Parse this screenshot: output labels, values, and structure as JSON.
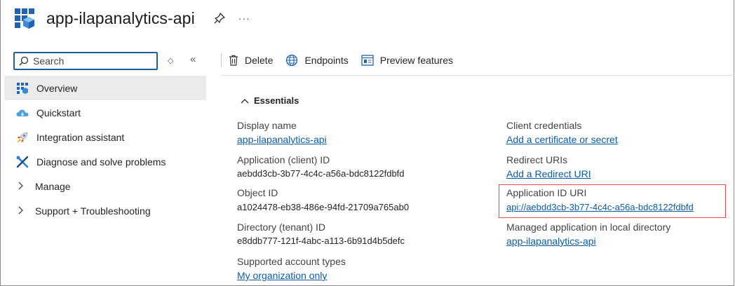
{
  "header": {
    "title": "app-ilapanalytics-api",
    "more_label": "···"
  },
  "sidebar": {
    "search_placeholder": "Search",
    "collapse_label": "«",
    "sort_label": "◇",
    "items": [
      {
        "label": "Overview"
      },
      {
        "label": "Quickstart"
      },
      {
        "label": "Integration assistant"
      },
      {
        "label": "Diagnose and solve problems"
      },
      {
        "label": "Manage"
      },
      {
        "label": "Support + Troubleshooting"
      }
    ]
  },
  "toolbar": {
    "delete_label": "Delete",
    "endpoints_label": "Endpoints",
    "preview_label": "Preview features"
  },
  "essentials": {
    "heading": "Essentials",
    "left": [
      {
        "label": "Display name",
        "value": "app-ilapanalytics-api",
        "link": true
      },
      {
        "label": "Application (client) ID",
        "value": "aebdd3cb-3b77-4c4c-a56a-bdc8122fdbfd",
        "link": false
      },
      {
        "label": "Object ID",
        "value": "a1024478-eb38-486e-94fd-21709a765ab0",
        "link": false
      },
      {
        "label": "Directory (tenant) ID",
        "value": "e8ddb777-121f-4abc-a113-6b91d4b5defc",
        "link": false
      },
      {
        "label": "Supported account types",
        "value": "My organization only",
        "link": true
      }
    ],
    "right": [
      {
        "label": "Client credentials",
        "value": "Add a certificate or secret",
        "link": true
      },
      {
        "label": "Redirect URIs",
        "value": "Add a Redirect URI",
        "link": true
      },
      {
        "label": "Application ID URI",
        "value": "api://aebdd3cb-3b77-4c4c-a56a-bdc8122fdbfd",
        "link": true
      },
      {
        "label": "Managed application in local directory",
        "value": "app-ilapanalytics-api",
        "link": true
      }
    ]
  },
  "colors": {
    "link": "#0b5cad",
    "highlight": "#e34b4b",
    "active_nav": "#ebebeb",
    "search_border": "#1f5f9e"
  }
}
